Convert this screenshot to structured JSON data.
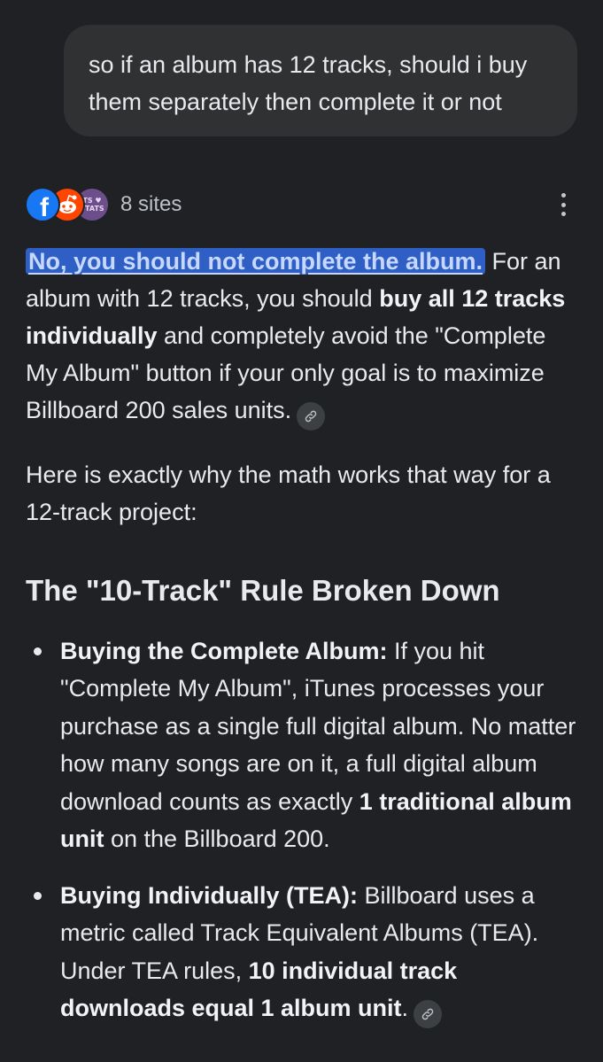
{
  "user_message": "so if an album has 12 tracks, should i buy them separately then complete it or not",
  "sources": {
    "count_label": "8 sites",
    "favicons": [
      "facebook-icon",
      "reddit-icon",
      "bts-stats-icon"
    ],
    "stats_text": "TS\nSTATS"
  },
  "answer": {
    "highlight": "No, you should not complete the album.",
    "p1_a": " For an album with 12 tracks, you should ",
    "p1_b": "buy all 12 tracks individually",
    "p1_c": " and completely avoid the \"Complete My Album\" button if your only goal is to maximize Billboard 200 sales units.",
    "p2": "Here is exactly why the math works that way for a 12-track project:",
    "heading": "The \"10-Track\" Rule Broken Down",
    "bullets": [
      {
        "title": "Buying the Complete Album:",
        "text_a": " If you hit \"Complete My Album\", iTunes processes your purchase as a single full digital album. No matter how many songs are on it, a full digital album download counts as exactly ",
        "bold": "1 traditional album unit",
        "text_b": " on the Billboard 200."
      },
      {
        "title": "Buying Individually (TEA):",
        "text_a": " Billboard uses a metric called Track Equivalent Albums (TEA). Under TEA rules, ",
        "bold": "10 individual track downloads equal 1 album unit",
        "text_b": "."
      }
    ]
  },
  "colors": {
    "background": "#202124",
    "bubble": "#2f3133",
    "highlight": "#2f5ec4",
    "link_chip": "#3c4043"
  }
}
